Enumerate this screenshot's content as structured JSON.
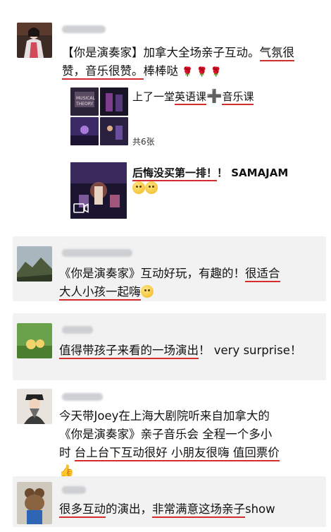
{
  "post": {
    "text_a": "【你是演奏家】加拿大全场亲子互动。",
    "text_b": "气氛很",
    "text_c": "赞，音乐很赞。",
    "text_d": "棒棒哒",
    "roses": "🌹 🌹 🌹",
    "link1_pre": "上了一堂",
    "link1_ul1": "英语课",
    "link1_plus": "➕",
    "link1_ul2": "音乐课",
    "photo_count": "共6张",
    "link2_ul": "后悔没买第一排！",
    "link2_rest": "！ SAMAJAM"
  },
  "comments": [
    {
      "pre": "《你是演奏家》互动好玩，有趣的！",
      "ul1": "很适合",
      "ul2": "大人小孩一起嗨"
    },
    {
      "ul1": "值得带孩子来看的一场演出",
      "post": "！ very surprise！"
    },
    {
      "line1": "今天带Joey在上海大剧院听来自加拿大的",
      "line2": "《你是演奏家》亲子音乐会 全程一个多小",
      "pre3": "时 ",
      "ul3": "台上台下互动很好 小朋友很嗨 值回票价"
    },
    {
      "ul1": "很多互动",
      "mid": "的演出，",
      "ul2": "非常满意这场亲子",
      "post": "show"
    }
  ],
  "icons": {
    "video": "video-camera-icon",
    "emoji": "grin-emoji-icon",
    "thumbs": "thumbs-up-icon",
    "rose": "rose-icon"
  }
}
